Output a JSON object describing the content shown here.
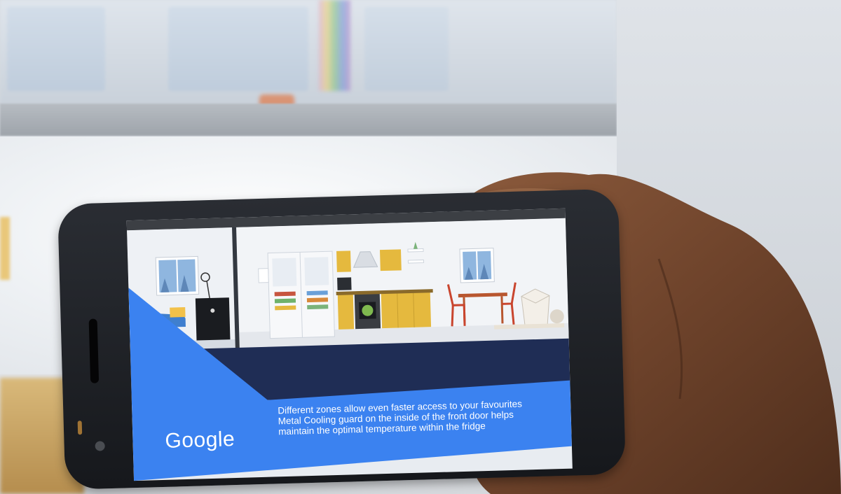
{
  "scene": {
    "phone_color": "#1d2025",
    "wall_color": "#d9dde2"
  },
  "screen": {
    "brand": "Google",
    "caption_lines": [
      "Different zones allow even faster access to your favourites",
      "Metal Cooling guard on the inside of the front door helps",
      "maintain the optimal temperature within the fridge"
    ],
    "colors": {
      "accent_blue": "#3b82f0",
      "navy": "#1f2d55",
      "cabinet_yellow": "#e5b93e",
      "window_blue": "#8fb6df"
    }
  },
  "icons": {
    "brand_logo": "google-logo",
    "illustration": "kitchen-illustration"
  }
}
